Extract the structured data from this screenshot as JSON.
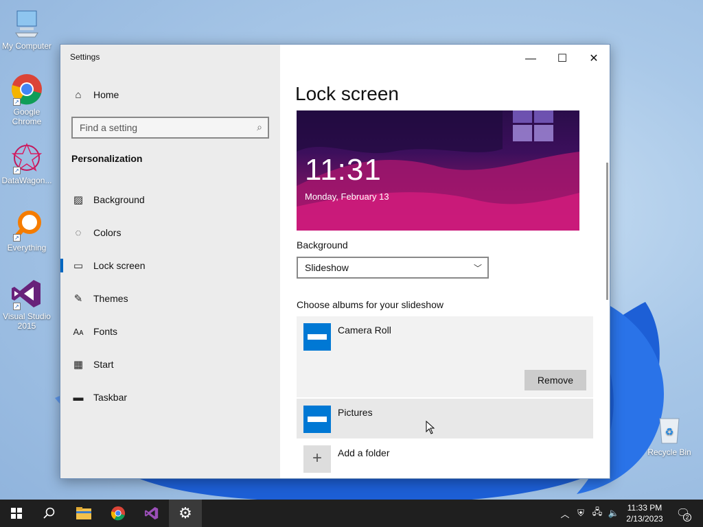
{
  "desktop": {
    "icons": [
      {
        "label": "My Computer"
      },
      {
        "label": "Google Chrome"
      },
      {
        "label": "DataWagon..."
      },
      {
        "label": "Everything"
      },
      {
        "label": "Visual Studio 2015"
      },
      {
        "label": "Recycle Bin"
      }
    ]
  },
  "window": {
    "title": "Settings",
    "controls": {
      "minimize": "—",
      "maximize": "☐",
      "close": "✕"
    }
  },
  "sidebar": {
    "home_label": "Home",
    "search_placeholder": "Find a setting",
    "section_title": "Personalization",
    "items": [
      {
        "label": "Background",
        "icon": "image-icon"
      },
      {
        "label": "Colors",
        "icon": "palette-icon"
      },
      {
        "label": "Lock screen",
        "icon": "lock-screen-icon",
        "active": true
      },
      {
        "label": "Themes",
        "icon": "brush-icon"
      },
      {
        "label": "Fonts",
        "icon": "font-icon"
      },
      {
        "label": "Start",
        "icon": "start-icon"
      },
      {
        "label": "Taskbar",
        "icon": "taskbar-icon"
      }
    ]
  },
  "main": {
    "title": "Lock screen",
    "preview": {
      "time": "11:31",
      "date": "Monday, February 13"
    },
    "background_label": "Background",
    "background_value": "Slideshow",
    "albums_label": "Choose albums for your slideshow",
    "albums": [
      {
        "name": "Camera Roll",
        "action": "Remove"
      },
      {
        "name": "Pictures"
      }
    ],
    "add_folder_label": "Add a folder"
  },
  "taskbar": {
    "clock_time": "11:33 PM",
    "clock_date": "2/13/2023",
    "notification_count": "2"
  },
  "colors": {
    "accent": "#0067c0",
    "album_thumb": "#0078d4",
    "taskbar": "#1f1f1f"
  }
}
